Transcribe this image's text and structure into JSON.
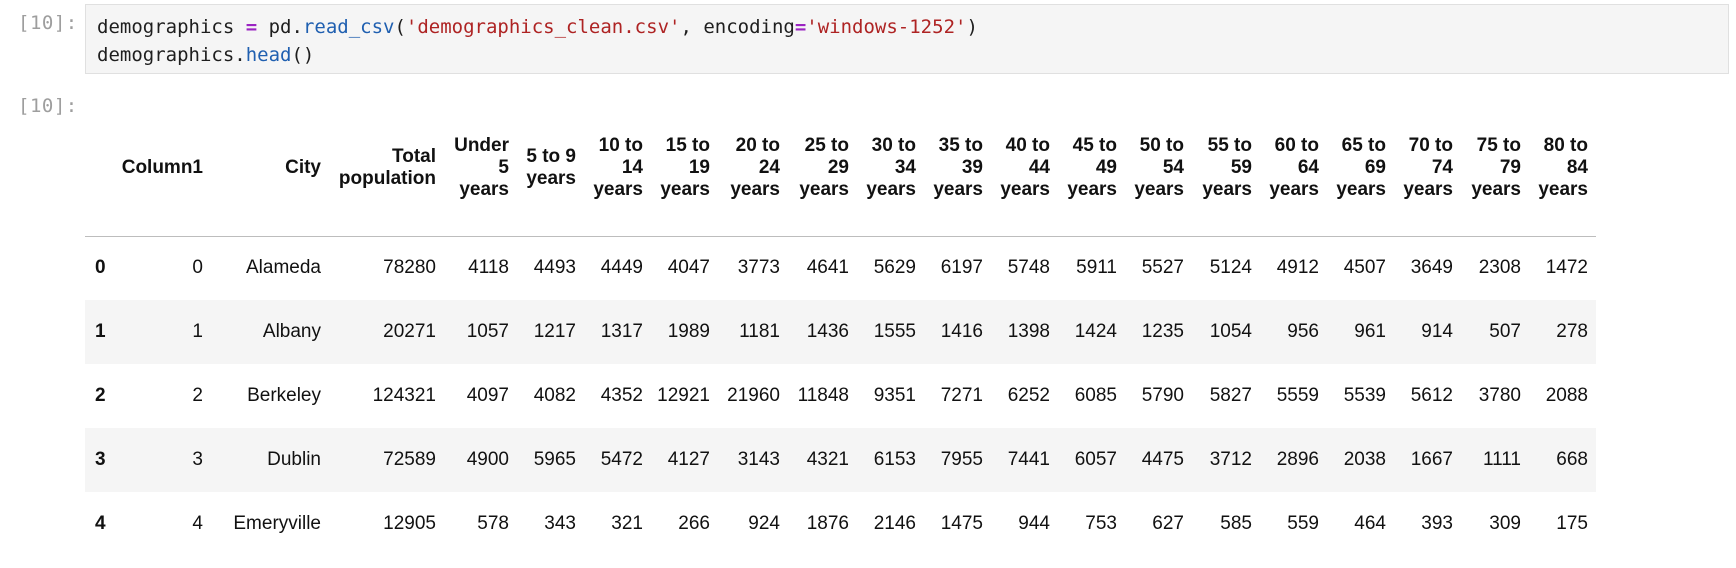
{
  "cells": {
    "input_prompt": "[10]:",
    "output_prompt": "[10]:",
    "code_lines": [
      [
        {
          "t": "demographics ",
          "c": ""
        },
        {
          "t": "=",
          "c": "tok-op"
        },
        {
          "t": " pd.",
          "c": ""
        },
        {
          "t": "read_csv",
          "c": "tok-fn"
        },
        {
          "t": "(",
          "c": ""
        },
        {
          "t": "'demographics_clean.csv'",
          "c": "tok-str"
        },
        {
          "t": ", encoding",
          "c": ""
        },
        {
          "t": "=",
          "c": "tok-op"
        },
        {
          "t": "'windows-1252'",
          "c": "tok-str"
        },
        {
          "t": ")",
          "c": ""
        }
      ],
      [
        {
          "t": "demographics.",
          "c": ""
        },
        {
          "t": "head",
          "c": "tok-fn"
        },
        {
          "t": "()",
          "c": ""
        }
      ]
    ]
  },
  "table": {
    "columns": [
      "Column1",
      "City",
      "Total population",
      "Under 5 years",
      "5 to 9 years",
      "10 to 14 years",
      "15 to 19 years",
      "20 to 24 years",
      "25 to 29 years",
      "30 to 34 years",
      "35 to 39 years",
      "40 to 44 years",
      "45 to 49 years",
      "50 to 54 years",
      "55 to 59 years",
      "60 to 64 years",
      "65 to 69 years",
      "70 to 74 years",
      "75 to 79 years",
      "80 to 84 years"
    ],
    "rows": [
      {
        "index": "0",
        "cells": [
          "0",
          "Alameda",
          "78280",
          "4118",
          "4493",
          "4449",
          "4047",
          "3773",
          "4641",
          "5629",
          "6197",
          "5748",
          "5911",
          "5527",
          "5124",
          "4912",
          "4507",
          "3649",
          "2308",
          "1472"
        ]
      },
      {
        "index": "1",
        "cells": [
          "1",
          "Albany",
          "20271",
          "1057",
          "1217",
          "1317",
          "1989",
          "1181",
          "1436",
          "1555",
          "1416",
          "1398",
          "1424",
          "1235",
          "1054",
          "956",
          "961",
          "914",
          "507",
          "278"
        ]
      },
      {
        "index": "2",
        "cells": [
          "2",
          "Berkeley",
          "124321",
          "4097",
          "4082",
          "4352",
          "12921",
          "21960",
          "11848",
          "9351",
          "7271",
          "6252",
          "6085",
          "5790",
          "5827",
          "5559",
          "5539",
          "5612",
          "3780",
          "2088"
        ]
      },
      {
        "index": "3",
        "cells": [
          "3",
          "Dublin",
          "72589",
          "4900",
          "5965",
          "5472",
          "4127",
          "3143",
          "4321",
          "6153",
          "7955",
          "7441",
          "6057",
          "4475",
          "3712",
          "2896",
          "2038",
          "1667",
          "1111",
          "668"
        ]
      },
      {
        "index": "4",
        "cells": [
          "4",
          "Emeryville",
          "12905",
          "578",
          "343",
          "321",
          "266",
          "924",
          "1876",
          "2146",
          "1475",
          "944",
          "753",
          "627",
          "585",
          "559",
          "464",
          "393",
          "309",
          "175"
        ]
      }
    ]
  }
}
